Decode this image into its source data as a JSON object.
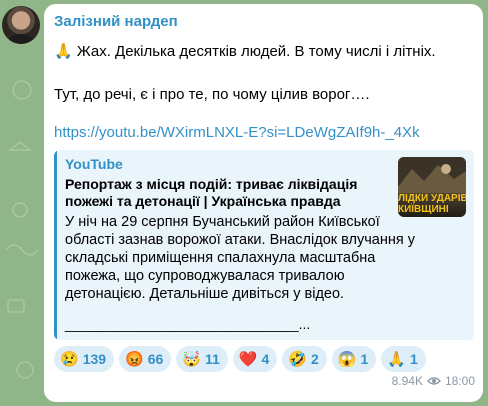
{
  "channel": {
    "name": "Залізний нардеп"
  },
  "message": {
    "line1_emoji": "🙏",
    "line1": "Жах. Декілька десятків людей. В тому числі і літніх.",
    "line2": "Тут, до речі, є і про те, по чому цілив ворог….",
    "link": "https://youtu.be/WXirmLNXL-E?si=LDeWgZAIf9h-_4Xk"
  },
  "preview": {
    "site": "YouTube",
    "title": "Репортаж з місця подій: триває ліквідація пожежі та детонації | Українська правда",
    "description": "У ніч на 29 серпня Бучанський район Київської області зазнав ворожої атаки. Внаслідок влучання у складські приміщення спалахнула масштабна пожежа, що супроводжувалася тривалою детонацією. Детальніше дивіться у відео.",
    "separator": "______________________________...",
    "thumb_line1": "ЛІДКИ УДАРІВ",
    "thumb_line2": "КИЇВЩИНІ"
  },
  "reactions": [
    {
      "emoji": "😢",
      "count": "139"
    },
    {
      "emoji": "😡",
      "count": "66"
    },
    {
      "emoji": "🤯",
      "count": "11"
    },
    {
      "emoji": "❤️",
      "count": "4"
    },
    {
      "emoji": "🤣",
      "count": "2"
    },
    {
      "emoji": "😱",
      "count": "1"
    },
    {
      "emoji": "🙏",
      "count": "1"
    }
  ],
  "meta": {
    "views": "8.94K",
    "time": "18:00"
  },
  "colors": {
    "accent": "#3390c7",
    "background": "#8fb588",
    "bubble": "#ffffff"
  }
}
